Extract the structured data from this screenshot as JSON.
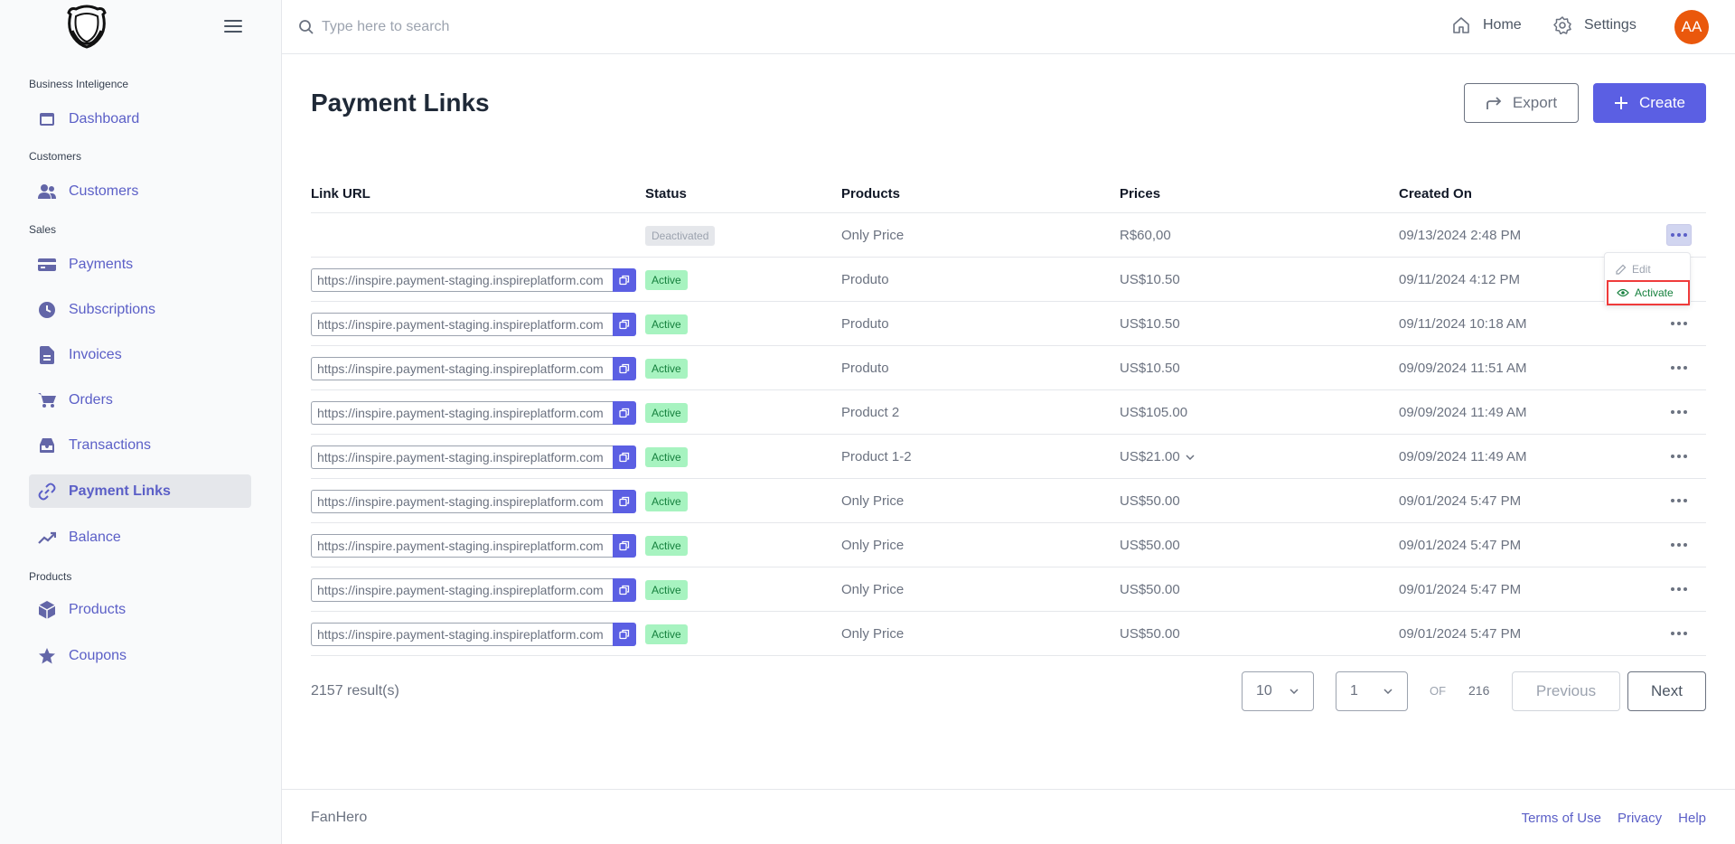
{
  "sidebar": {
    "sections": [
      {
        "title": "Business Inteligence",
        "items": [
          {
            "label": "Dashboard",
            "icon": "dashboard-icon"
          }
        ]
      },
      {
        "title": "Customers",
        "items": [
          {
            "label": "Customers",
            "icon": "users-icon"
          }
        ]
      },
      {
        "title": "Sales",
        "items": [
          {
            "label": "Payments",
            "icon": "credit-card-icon"
          },
          {
            "label": "Subscriptions",
            "icon": "clock-icon"
          },
          {
            "label": "Invoices",
            "icon": "document-icon"
          },
          {
            "label": "Orders",
            "icon": "cart-icon"
          },
          {
            "label": "Transactions",
            "icon": "inbox-icon"
          },
          {
            "label": "Payment Links",
            "icon": "link-icon",
            "active": true
          },
          {
            "label": "Balance",
            "icon": "trending-up-icon"
          }
        ]
      },
      {
        "title": "Products",
        "items": [
          {
            "label": "Products",
            "icon": "cube-icon"
          },
          {
            "label": "Coupons",
            "icon": "star-icon"
          }
        ]
      }
    ]
  },
  "topbar": {
    "search_placeholder": "Type here to search",
    "home_label": "Home",
    "settings_label": "Settings",
    "avatar_initials": "AA",
    "avatar_color": "#ea580c"
  },
  "main": {
    "title": "Payment Links",
    "export_label": "Export",
    "create_label": "Create",
    "columns": [
      "Link URL",
      "Status",
      "Products",
      "Prices",
      "Created On"
    ],
    "rows": [
      {
        "url": "",
        "status": "Deactivated",
        "product": "Only Price",
        "price": "R$60,00",
        "created": "09/13/2024 2:48 PM",
        "menu_open": true
      },
      {
        "url": "https://inspire.payment-staging.inspireplatform.com",
        "status": "Active",
        "product": "Produto",
        "price": "US$10.50",
        "created": "09/11/2024 4:12 PM"
      },
      {
        "url": "https://inspire.payment-staging.inspireplatform.com",
        "status": "Active",
        "product": "Produto",
        "price": "US$10.50",
        "created": "09/11/2024 10:18 AM"
      },
      {
        "url": "https://inspire.payment-staging.inspireplatform.com",
        "status": "Active",
        "product": "Produto",
        "price": "US$10.50",
        "created": "09/09/2024 11:51 AM"
      },
      {
        "url": "https://inspire.payment-staging.inspireplatform.com",
        "status": "Active",
        "product": "Product 2",
        "price": "US$105.00",
        "created": "09/09/2024 11:49 AM"
      },
      {
        "url": "https://inspire.payment-staging.inspireplatform.com",
        "status": "Active",
        "product": "Product 1-2",
        "price": "US$21.00",
        "price_expandable": true,
        "created": "09/09/2024 11:49 AM"
      },
      {
        "url": "https://inspire.payment-staging.inspireplatform.com",
        "status": "Active",
        "product": "Only Price",
        "price": "US$50.00",
        "created": "09/01/2024 5:47 PM"
      },
      {
        "url": "https://inspire.payment-staging.inspireplatform.com",
        "status": "Active",
        "product": "Only Price",
        "price": "US$50.00",
        "created": "09/01/2024 5:47 PM"
      },
      {
        "url": "https://inspire.payment-staging.inspireplatform.com",
        "status": "Active",
        "product": "Only Price",
        "price": "US$50.00",
        "created": "09/01/2024 5:47 PM"
      },
      {
        "url": "https://inspire.payment-staging.inspireplatform.com",
        "status": "Active",
        "product": "Only Price",
        "price": "US$50.00",
        "created": "09/01/2024 5:47 PM"
      }
    ],
    "row_menu": {
      "edit_label": "Edit",
      "activate_label": "Activate"
    }
  },
  "pagination": {
    "results": "2157 result(s)",
    "page_size": "10",
    "page": "1",
    "of_label": "OF",
    "total_pages": "216",
    "previous_label": "Previous",
    "next_label": "Next"
  },
  "footer": {
    "brand": "FanHero",
    "links": [
      "Terms of Use",
      "Privacy",
      "Help"
    ]
  },
  "colors": {
    "accent": "#5b5fe3",
    "active_badge": "#a7f3c0",
    "highlight": "#ef3b3b"
  }
}
